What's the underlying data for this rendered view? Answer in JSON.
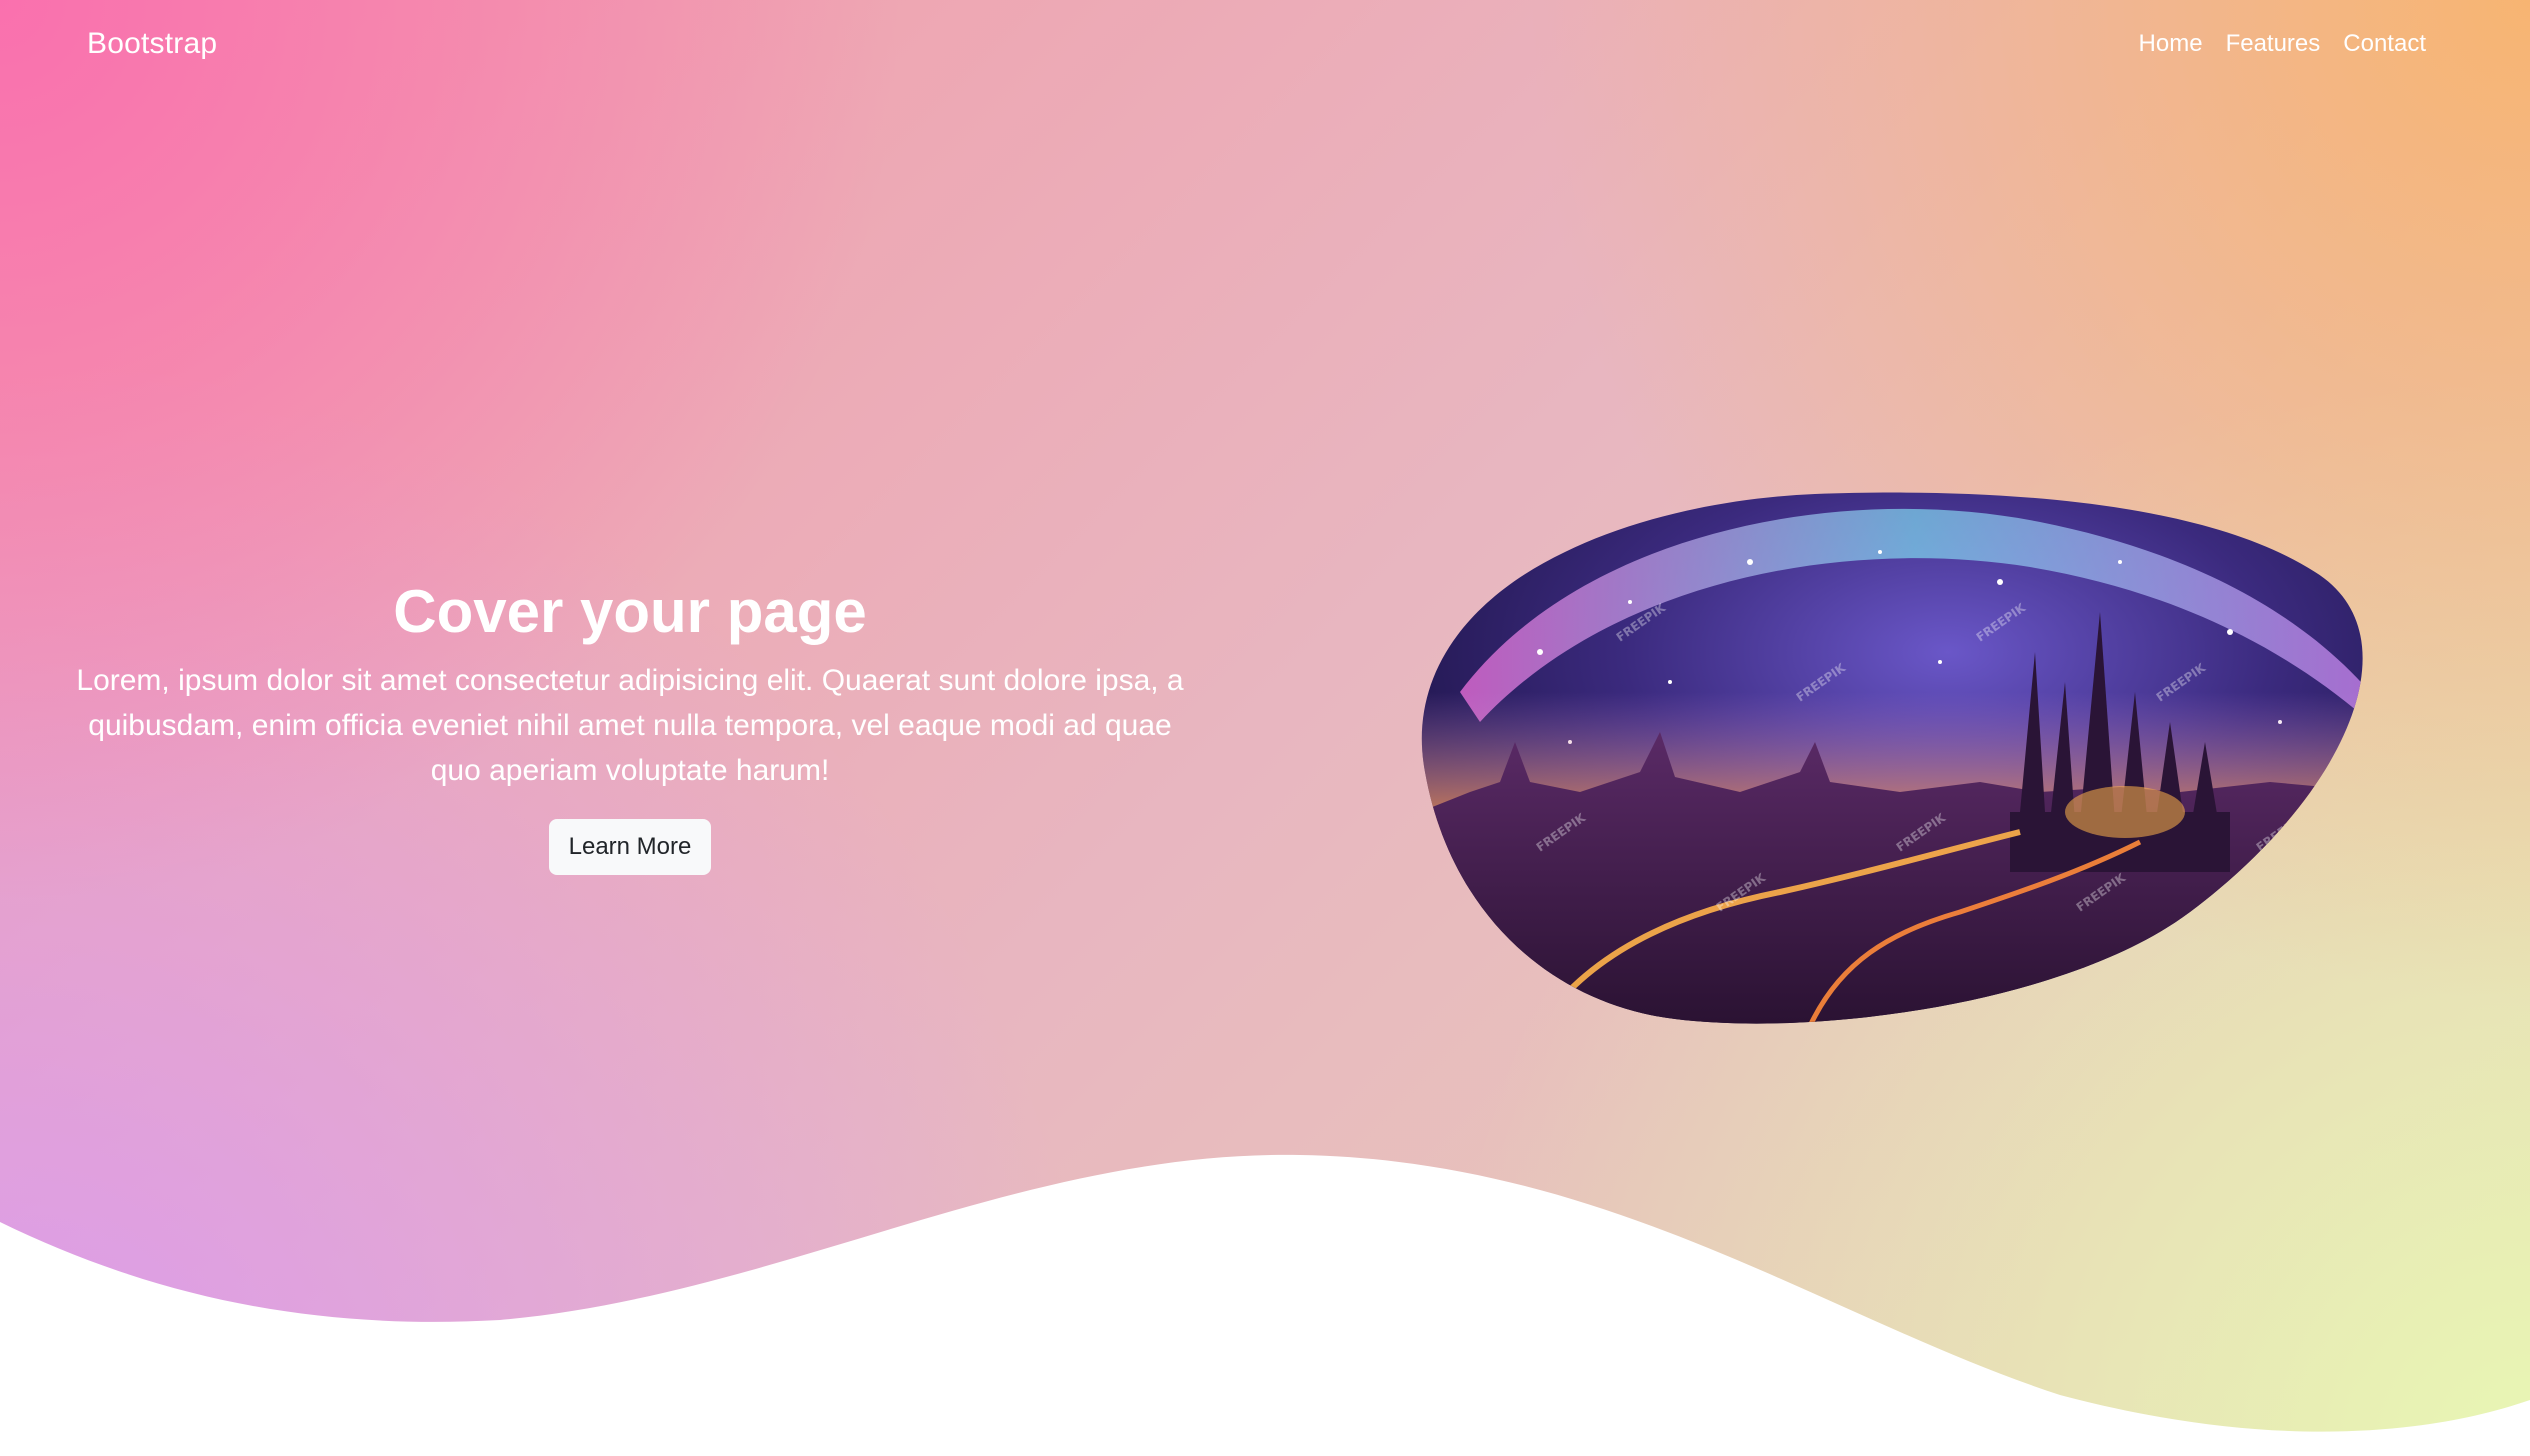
{
  "nav": {
    "brand": "Bootstrap",
    "links": [
      "Home",
      "Features",
      "Contact"
    ]
  },
  "hero": {
    "title": "Cover your page",
    "text": "Lorem, ipsum dolor sit amet consectetur adipisicing elit. Quaerat sunt dolore ipsa, a quibusdam, enim officia eveniet nihil amet nulla tempora, vel eaque modi ad quae quo aperiam voluptate harum!",
    "button_label": "Learn More"
  },
  "image": {
    "subject": "fantasy galaxy castle landscape",
    "watermark": "FREEPIK"
  },
  "colors": {
    "gradient_top_left": "#fa6eaf",
    "gradient_top_right": "#f8b46e",
    "gradient_bottom_left": "#da9bf0",
    "gradient_bottom_right": "#e8f8b4",
    "wave_fill": "#ffffff",
    "text": "#ffffff",
    "button_bg": "#f8f9fa",
    "button_text": "#212529"
  }
}
